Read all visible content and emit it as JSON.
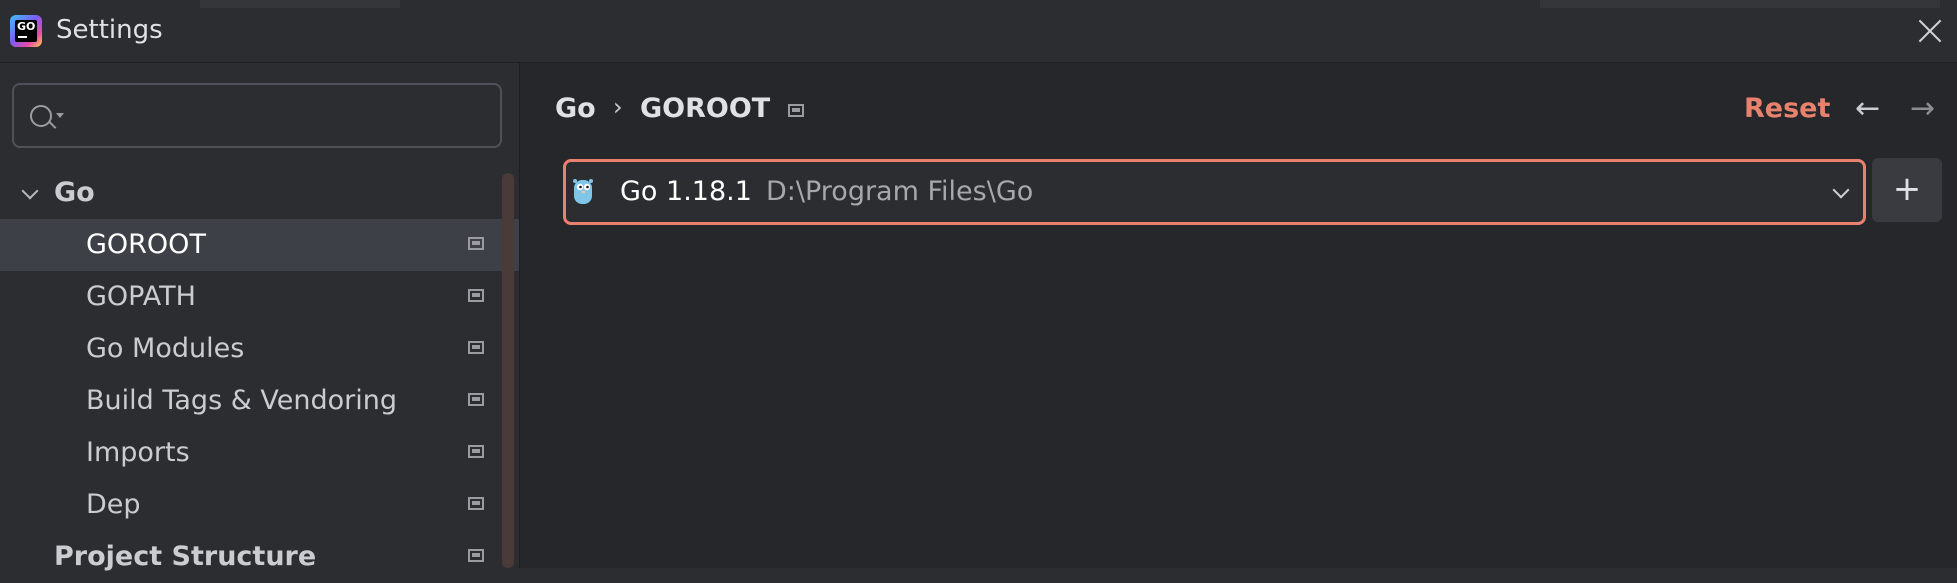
{
  "window": {
    "title": "Settings",
    "app_icon": "goland-icon"
  },
  "sidebar": {
    "search_placeholder": "",
    "items": [
      {
        "label": "Go",
        "type": "group",
        "expanded": true
      },
      {
        "label": "GOROOT",
        "selected": true
      },
      {
        "label": "GOPATH"
      },
      {
        "label": "Go Modules"
      },
      {
        "label": "Build Tags & Vendoring"
      },
      {
        "label": "Imports"
      },
      {
        "label": "Dep"
      },
      {
        "label": "Project Structure",
        "type": "group"
      }
    ]
  },
  "breadcrumb": {
    "parent": "Go",
    "separator": "›",
    "current": "GOROOT"
  },
  "toolbar": {
    "reset_label": "Reset",
    "back_icon": "←",
    "forward_icon": "→"
  },
  "sdk": {
    "name": "Go 1.18.1",
    "path": "D:\\Program Files\\Go"
  },
  "add_label": "+",
  "colors": {
    "accent": "#e8826f",
    "background": "#2b2d30",
    "selected": "#3d4047"
  }
}
